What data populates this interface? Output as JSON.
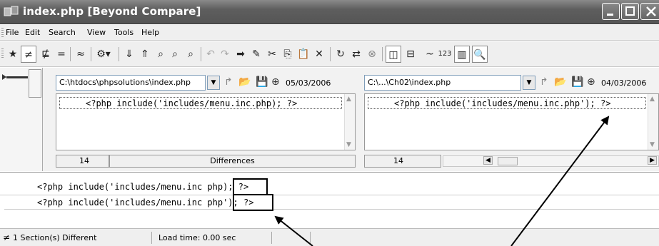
{
  "window": {
    "title": "index.php  [Beyond Compare]"
  },
  "menu": {
    "items": [
      "File",
      "Edit",
      "Search",
      "View",
      "Tools",
      "Help"
    ]
  },
  "toolbar": {
    "counter_label": "123"
  },
  "left": {
    "path": "C:\\htdocs\\phpsolutions\\index.php",
    "date": "05/03/2006",
    "code_line": "<?php include('includes/menu.inc.php); ?>",
    "line_number": "14",
    "status_label": "Differences"
  },
  "right": {
    "path": "C:\\...\\Ch02\\index.php",
    "date": "04/03/2006",
    "code_line": "<?php include('includes/menu.inc.php'); ?>",
    "line_number": "14"
  },
  "diff": {
    "line_a": "<?php include('includes/menu.inc php); ?>",
    "line_b": "<?php include('includes/menu.inc php'); ?>"
  },
  "status": {
    "sections": "1 Section(s) Different",
    "load_time": "Load time:  0.00 sec"
  }
}
